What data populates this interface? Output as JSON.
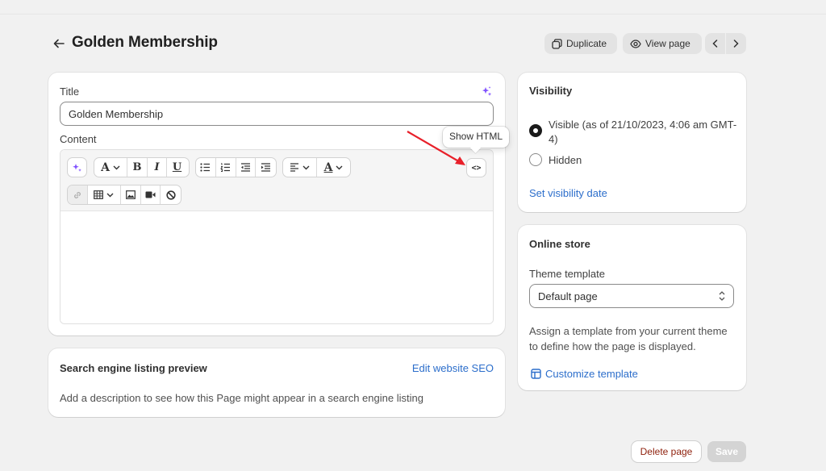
{
  "header": {
    "title": "Golden Membership",
    "duplicate_label": "Duplicate",
    "view_label": "View page",
    "icons": [
      "arrow-left-icon",
      "duplicate-icon",
      "eye-icon",
      "chevron-left-icon",
      "chevron-right-icon"
    ]
  },
  "main": {
    "title_label": "Title",
    "title_value": "Golden Membership",
    "content_label": "Content",
    "show_html_label": "<>",
    "tooltip": "Show HTML",
    "toolbar_icons": [
      "magic-icon",
      "font-icon",
      "bold-icon",
      "italic-icon",
      "underline-icon",
      "bullet-list-icon",
      "numbered-list-icon",
      "outdent-icon",
      "indent-icon",
      "align-icon",
      "text-color-icon",
      "link-icon",
      "table-icon",
      "image-icon",
      "video-icon",
      "clear-format-icon"
    ],
    "annotation_color": "#e8202a"
  },
  "seo": {
    "title": "Search engine listing preview",
    "edit_link": "Edit website SEO",
    "description": "Add a description to see how this Page might appear in a search engine listing"
  },
  "visibility": {
    "title": "Visibility",
    "visible_label": "Visible (as of 21/10/2023, 4:06 am GMT-4)",
    "hidden_label": "Hidden",
    "selected": "visible",
    "set_date_link": "Set visibility date"
  },
  "store": {
    "title": "Online store",
    "template_label": "Theme template",
    "template_value": "Default page",
    "help_text": "Assign a template from your current theme to define how the page is displayed.",
    "customize_link": "Customize template"
  },
  "footer": {
    "delete_label": "Delete page",
    "save_label": "Save"
  },
  "colors": {
    "accent": "#2c6ecb",
    "danger": "#8e1f0b",
    "magic": "#8051ff"
  }
}
